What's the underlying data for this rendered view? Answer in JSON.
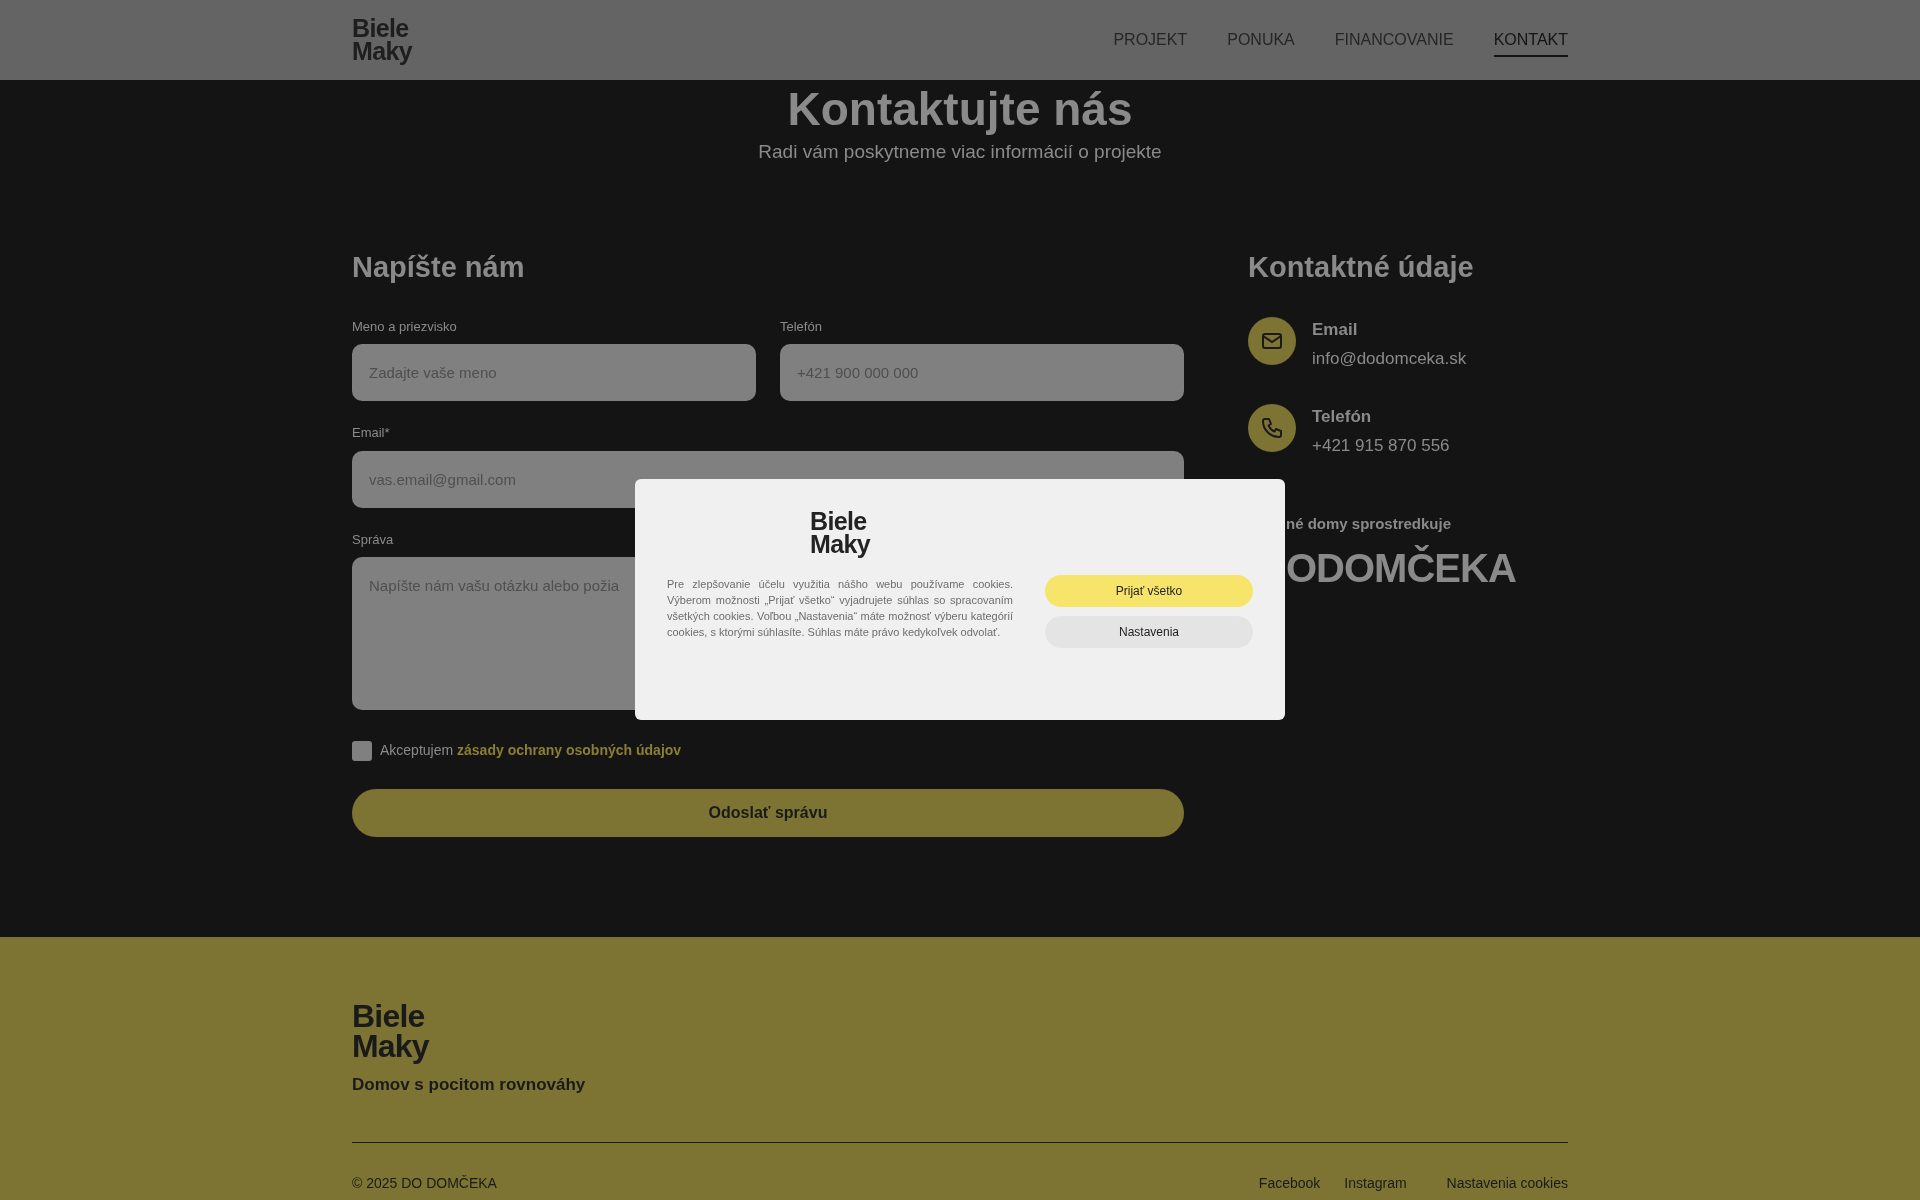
{
  "header": {
    "logo": [
      "Biele",
      "Maky"
    ],
    "nav": [
      {
        "label": "PROJEKT",
        "selected": false
      },
      {
        "label": "PONUKA",
        "selected": false
      },
      {
        "label": "FINANCOVANIE",
        "selected": false
      },
      {
        "label": "KONTAKT",
        "selected": true
      }
    ]
  },
  "hero": {
    "title": "Kontaktujte nás",
    "subtitle": "Radi vám poskytneme viac informácií o projekte"
  },
  "form": {
    "heading": "Napíšte nám",
    "fields": [
      {
        "label": "Meno a priezvisko",
        "placeholder": "Zadajte vaše meno"
      },
      {
        "label": "Telefón",
        "placeholder": "+421 900 000 000"
      },
      {
        "label": "Email*",
        "placeholder": "vas.email@gmail.com"
      },
      {
        "label": "Správa",
        "placeholder": "Napíšte nám vašu otázku alebo požia"
      }
    ],
    "consent": {
      "checked": false,
      "text": "Akceptujem",
      "link": "zásady ochrany osobných údajov"
    },
    "submit": "Odoslať správu"
  },
  "contact": {
    "heading": "Kontaktné údaje",
    "items": [
      {
        "kind": "email",
        "label": "Email",
        "value": "info@dodomceka.sk"
      },
      {
        "kind": "phone",
        "label": "Telefón",
        "value": "+421 915 870 556"
      }
    ],
    "broker_note": "né domy sprostredkuje",
    "broker_logo": "ODOMČEKA"
  },
  "footer": {
    "logo": [
      "Biele",
      "Maky"
    ],
    "tagline": "Domov s pocitom rovnováhy",
    "copyright": "© 2025 DO DOMČEKA",
    "links": [
      "Facebook",
      "Instagram",
      "Nastavenia cookies"
    ]
  },
  "cookie_dialog": {
    "logo": [
      "Biele",
      "Maky"
    ],
    "text": "Pre zlepšovanie účelu využitia nášho webu používame cookies. Výberom možnosti „Prijať všetko“ vyjadrujete súhlas so spracovaním všetkých cookies. Voľbou „Nastavenia“ máte možnosť výberu kategórií cookies, s ktorými súhlasíte. Súhlas máte právo kedykoľvek odvolať.",
    "buttons": [
      {
        "kind": "primary",
        "label": "Prijať všetko"
      },
      {
        "kind": "secondary",
        "label": "Nastavenia"
      }
    ]
  }
}
